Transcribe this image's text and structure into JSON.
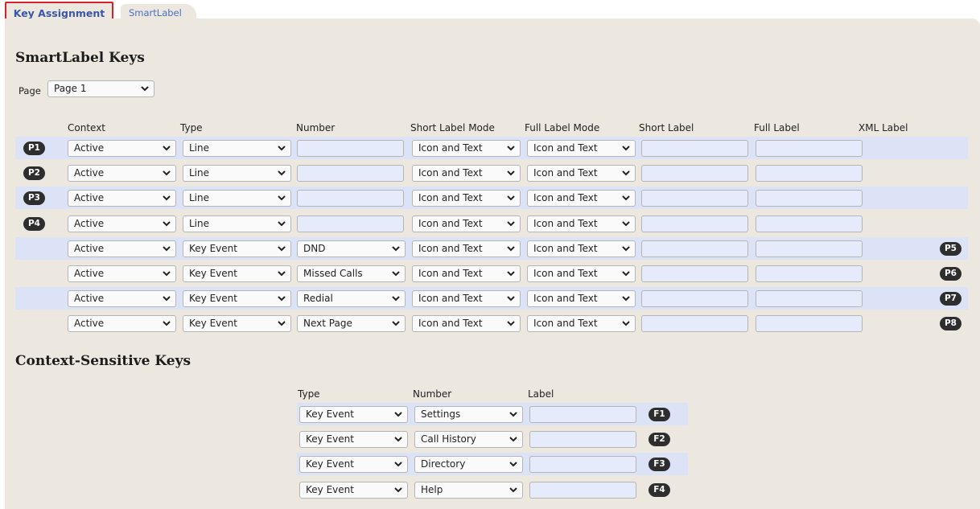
{
  "tabs": {
    "active": "Key Assignment",
    "other": "SmartLabel"
  },
  "smartlabel": {
    "heading": "SmartLabel Keys",
    "page_label": "Page",
    "page_value": "Page 1",
    "columns": {
      "context": "Context",
      "type": "Type",
      "number": "Number",
      "short_mode": "Short Label Mode",
      "full_mode": "Full Label Mode",
      "short_label": "Short Label",
      "full_label": "Full Label",
      "xml_label": "XML Label"
    },
    "rows": [
      {
        "key": "P1",
        "context": "Active",
        "type": "Line",
        "number": "",
        "short_mode": "Icon and Text",
        "full_mode": "Icon and Text",
        "short_label": "",
        "full_label": ""
      },
      {
        "key": "P2",
        "context": "Active",
        "type": "Line",
        "number": "",
        "short_mode": "Icon and Text",
        "full_mode": "Icon and Text",
        "short_label": "",
        "full_label": ""
      },
      {
        "key": "P3",
        "context": "Active",
        "type": "Line",
        "number": "",
        "short_mode": "Icon and Text",
        "full_mode": "Icon and Text",
        "short_label": "",
        "full_label": ""
      },
      {
        "key": "P4",
        "context": "Active",
        "type": "Line",
        "number": "",
        "short_mode": "Icon and Text",
        "full_mode": "Icon and Text",
        "short_label": "",
        "full_label": ""
      },
      {
        "key": "P5",
        "context": "Active",
        "type": "Key Event",
        "number": "DND",
        "short_mode": "Icon and Text",
        "full_mode": "Icon and Text",
        "short_label": "",
        "full_label": ""
      },
      {
        "key": "P6",
        "context": "Active",
        "type": "Key Event",
        "number": "Missed Calls",
        "short_mode": "Icon and Text",
        "full_mode": "Icon and Text",
        "short_label": "",
        "full_label": ""
      },
      {
        "key": "P7",
        "context": "Active",
        "type": "Key Event",
        "number": "Redial",
        "short_mode": "Icon and Text",
        "full_mode": "Icon and Text",
        "short_label": "",
        "full_label": ""
      },
      {
        "key": "P8",
        "context": "Active",
        "type": "Key Event",
        "number": "Next Page",
        "short_mode": "Icon and Text",
        "full_mode": "Icon and Text",
        "short_label": "",
        "full_label": ""
      }
    ]
  },
  "context_keys": {
    "heading": "Context-Sensitive Keys",
    "columns": {
      "type": "Type",
      "number": "Number",
      "label": "Label"
    },
    "rows": [
      {
        "key": "F1",
        "type": "Key Event",
        "number": "Settings",
        "label": ""
      },
      {
        "key": "F2",
        "type": "Key Event",
        "number": "Call History",
        "label": ""
      },
      {
        "key": "F3",
        "type": "Key Event",
        "number": "Directory",
        "label": ""
      },
      {
        "key": "F4",
        "type": "Key Event",
        "number": "Help",
        "label": ""
      }
    ]
  },
  "colors": {
    "panel_bg": "#ece8df",
    "row_highlight": "#dde3f6",
    "input_bg": "#e6ebfb",
    "pill_bg": "#2e2e2e",
    "active_tab_border": "#d6232b",
    "tab_text": "#3a56a8"
  },
  "icons": {
    "dropdown": "chevron-down-icon"
  }
}
